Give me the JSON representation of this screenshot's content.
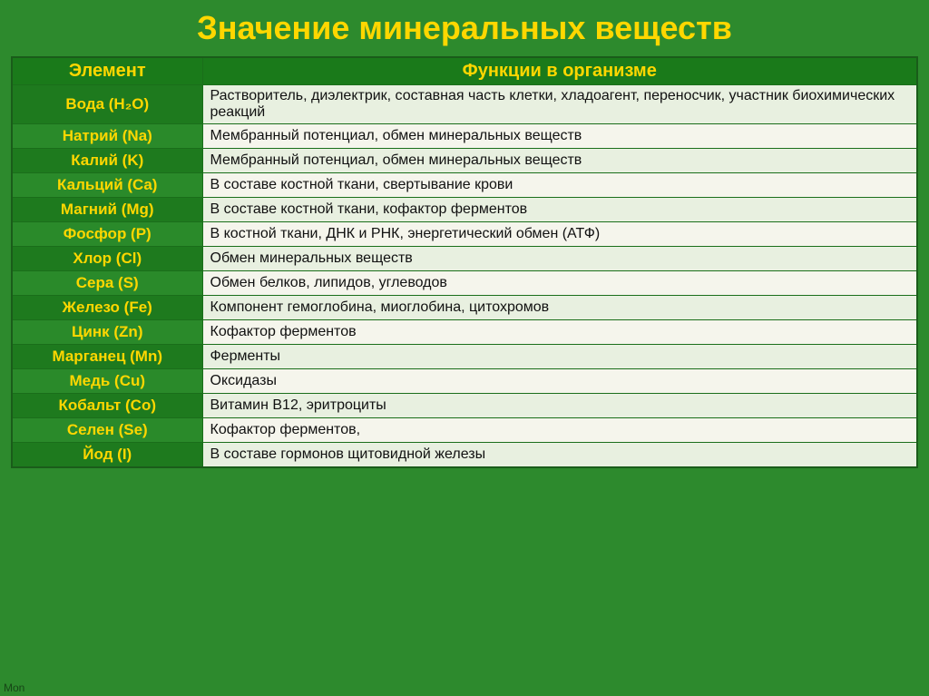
{
  "page": {
    "title": "Значение минеральных веществ",
    "bottom_label": "Mon"
  },
  "table": {
    "headers": {
      "element": "Элемент",
      "function": "Функции в организме"
    },
    "rows": [
      {
        "element": "Вода (H₂O)",
        "function": "Растворитель, диэлектрик, составная часть клетки, хладоагент, переносчик, участник биохимических реакций"
      },
      {
        "element": "Натрий (Na)",
        "function": "Мембранный потенциал, обмен минеральных веществ"
      },
      {
        "element": "Калий (K)",
        "function": "Мембранный потенциал, обмен минеральных веществ"
      },
      {
        "element": "Кальций (Ca)",
        "function": "В составе костной ткани, свертывание крови"
      },
      {
        "element": "Магний (Mg)",
        "function": "В составе костной ткани, кофактор ферментов"
      },
      {
        "element": "Фосфор (P)",
        "function": "В костной ткани,  ДНК и РНК, энергетический обмен  (АТФ)"
      },
      {
        "element": "Хлор (Cl)",
        "function": "Обмен минеральных веществ"
      },
      {
        "element": "Сера (S)",
        "function": "Обмен белков, липидов, углеводов"
      },
      {
        "element": "Железо (Fe)",
        "function": "Компонент гемоглобина, миоглобина, цитохромов"
      },
      {
        "element": "Цинк (Zn)",
        "function": "Кофактор ферментов"
      },
      {
        "element": "Марганец (Mn)",
        "function": "Ферменты"
      },
      {
        "element": "Медь (Cu)",
        "function": "Оксидазы"
      },
      {
        "element": "Кобальт (Co)",
        "function": "Витамин В12, эритроциты"
      },
      {
        "element": "Селен (Se)",
        "function": "Кофактор ферментов,"
      },
      {
        "element": "Йод (I)",
        "function": "В составе гормонов щитовидной железы"
      }
    ]
  }
}
